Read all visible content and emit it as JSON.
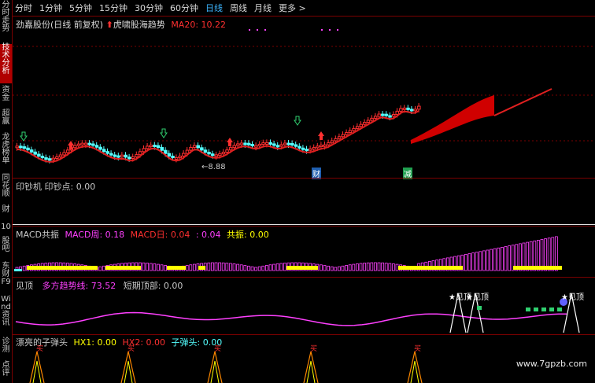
{
  "tabs": [
    "分时",
    "1分钟",
    "5分钟",
    "15分钟",
    "30分钟",
    "60分钟",
    "日线",
    "周线",
    "月线",
    "更多 >"
  ],
  "active_tab": "日线",
  "sidebar": [
    "分时走势",
    "技术分析",
    "资金",
    "超赢",
    "龙虎榜单",
    "同花顺",
    "财",
    "10",
    "股吧",
    "东财F9",
    "Wind资讯",
    "诊测",
    "点评"
  ],
  "main": {
    "title": "劲嘉股份(日线 前复权)",
    "indicator_name": "虎啸股海趋势",
    "ma_label": "MA20: 10.22",
    "low_price_label": "8.88",
    "badge_cai": "财",
    "badge_jian": "减"
  },
  "p1": {
    "title": "印钞机",
    "val": "印钞点: 0.00"
  },
  "p2": {
    "title": "MACD共振",
    "v1": "MACD周: 0.18",
    "v2": "MACD日: 0.04",
    "v3": ": 0.04",
    "v4": "共振: 0.00"
  },
  "p3": {
    "title": "见顶",
    "v1": "多方趋势线: 73.52",
    "v2": "短期顶部: 0.00",
    "label1": "见顶",
    "label2": "见顶",
    "label3": "见顶"
  },
  "p4": {
    "title": "漂亮的子弹头",
    "v1": "HX1: 0.00",
    "v2": "HX2: 0.00",
    "v3": "子弹头: 0.00",
    "buy": "买"
  },
  "watermark": "www.7gpzb.com",
  "colors": {
    "up": "#ff3030",
    "down": "#54ffff",
    "ma": "#e02020",
    "magenta": "#ff40ff",
    "yellow": "#ffff00",
    "blue": "#3db6ff",
    "green": "#30d070"
  }
}
